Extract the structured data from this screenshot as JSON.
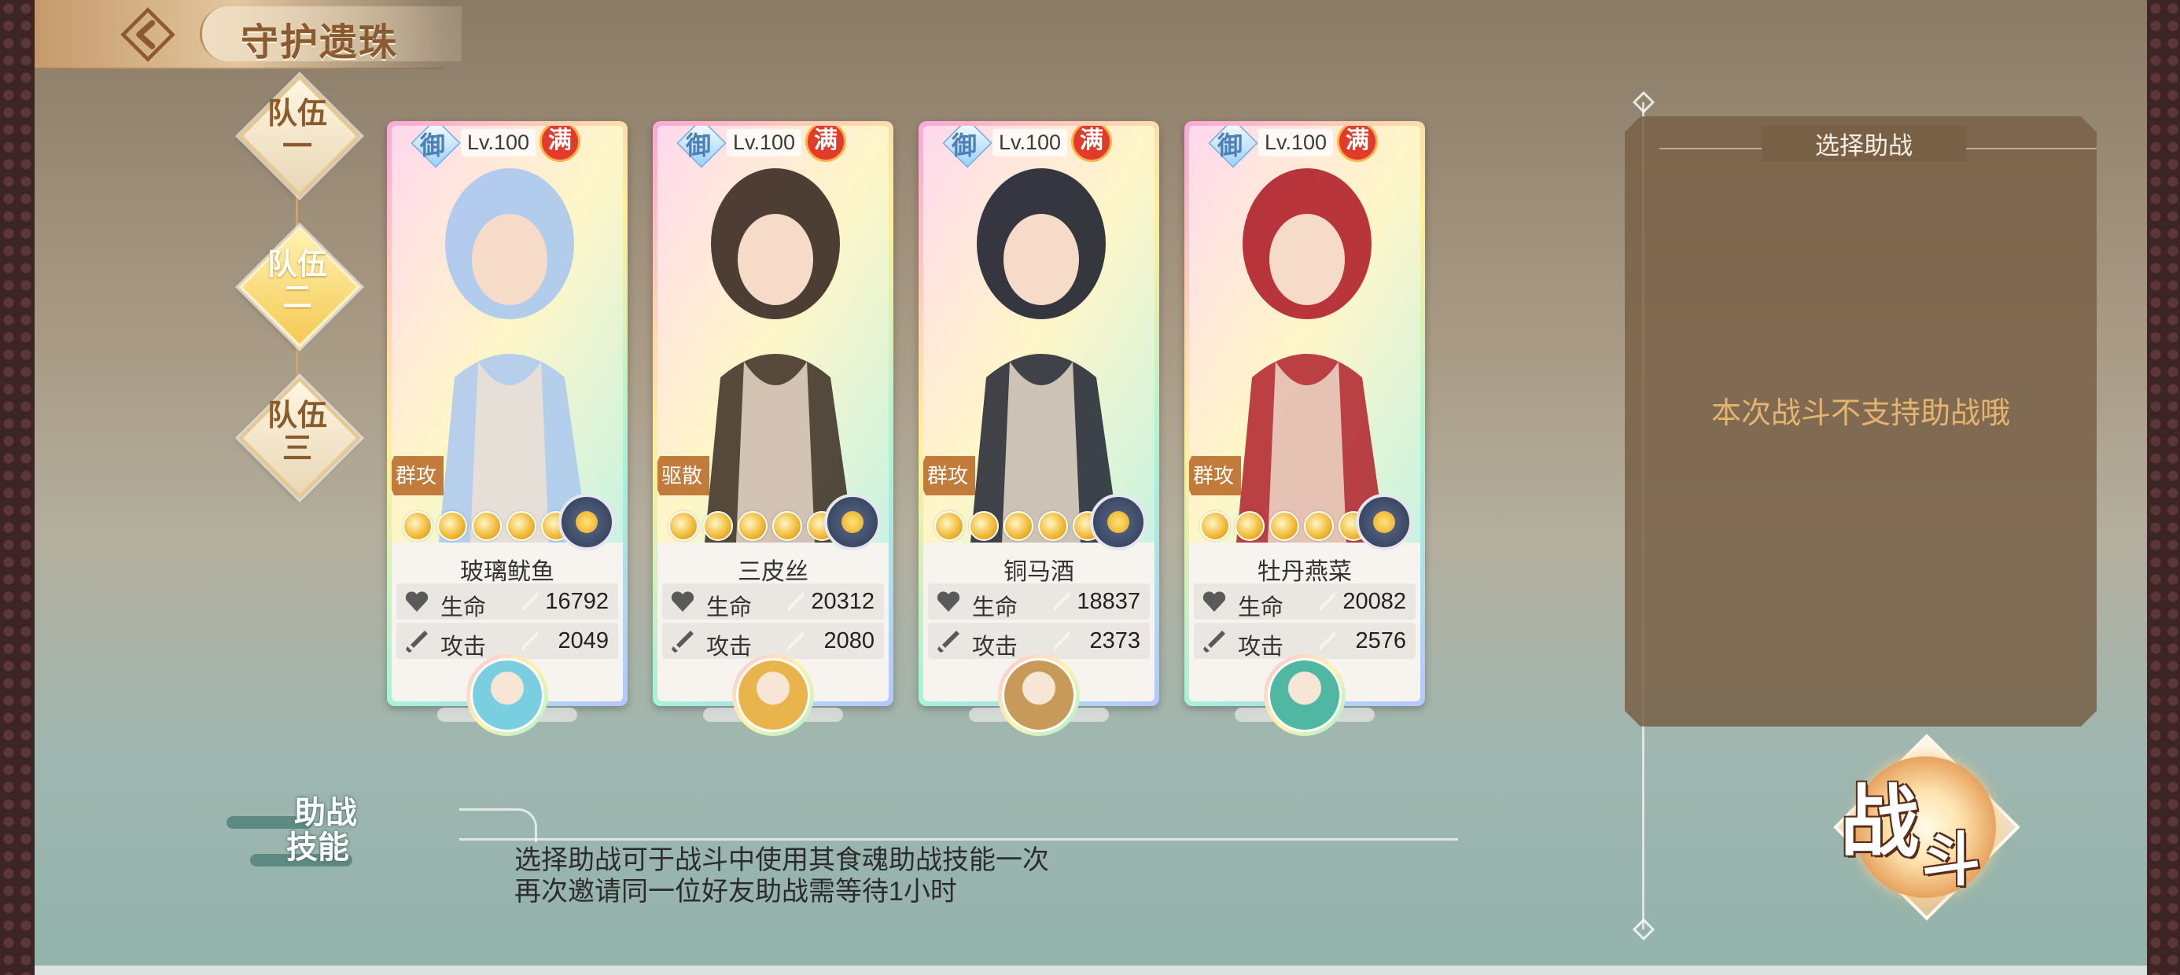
{
  "header": {
    "title": "守护遗珠"
  },
  "teams": [
    {
      "label": "队伍一",
      "active": false
    },
    {
      "label": "队伍二",
      "active": true
    },
    {
      "label": "队伍三",
      "active": false
    }
  ],
  "cards": [
    {
      "yu": "御",
      "level": "Lv.100",
      "full_badge": "满",
      "role": "群攻",
      "stars": 6,
      "name": "玻璃鱿鱼",
      "hp_label": "生命",
      "hp": "16792",
      "atk_label": "攻击",
      "atk": "2049",
      "theme": "#aac8f0",
      "support_color": "#79cfe0"
    },
    {
      "yu": "御",
      "level": "Lv.100",
      "full_badge": "满",
      "role": "驱散",
      "stars": 6,
      "name": "三皮丝",
      "hp_label": "生命",
      "hp": "20312",
      "atk_label": "攻击",
      "atk": "2080",
      "theme": "#3a2a22",
      "support_color": "#e9b44c"
    },
    {
      "yu": "御",
      "level": "Lv.100",
      "full_badge": "满",
      "role": "群攻",
      "stars": 6,
      "name": "铜马酒",
      "hp_label": "生命",
      "hp": "18837",
      "atk_label": "攻击",
      "atk": "2373",
      "theme": "#1f2230",
      "support_color": "#c79a5a"
    },
    {
      "yu": "御",
      "level": "Lv.100",
      "full_badge": "满",
      "role": "群攻",
      "stars": 6,
      "name": "牡丹燕菜",
      "hp_label": "生命",
      "hp": "20082",
      "atk_label": "攻击",
      "atk": "2576",
      "theme": "#b0202a",
      "support_color": "#4fb7a2"
    }
  ],
  "skill": {
    "title_line1": "助战",
    "title_line2": "技能",
    "desc_line1": "选择助战可于战斗中使用其食魂助战技能一次",
    "desc_line2": "再次邀请同一位好友助战需等待1小时"
  },
  "assist": {
    "title": "选择助战",
    "message": "本次战斗不支持助战哦"
  },
  "battle": {
    "char1": "战",
    "char2": "斗"
  },
  "icons": {
    "back": "back-arrow-icon",
    "hp": "heart-icon",
    "atk": "sword-icon"
  }
}
